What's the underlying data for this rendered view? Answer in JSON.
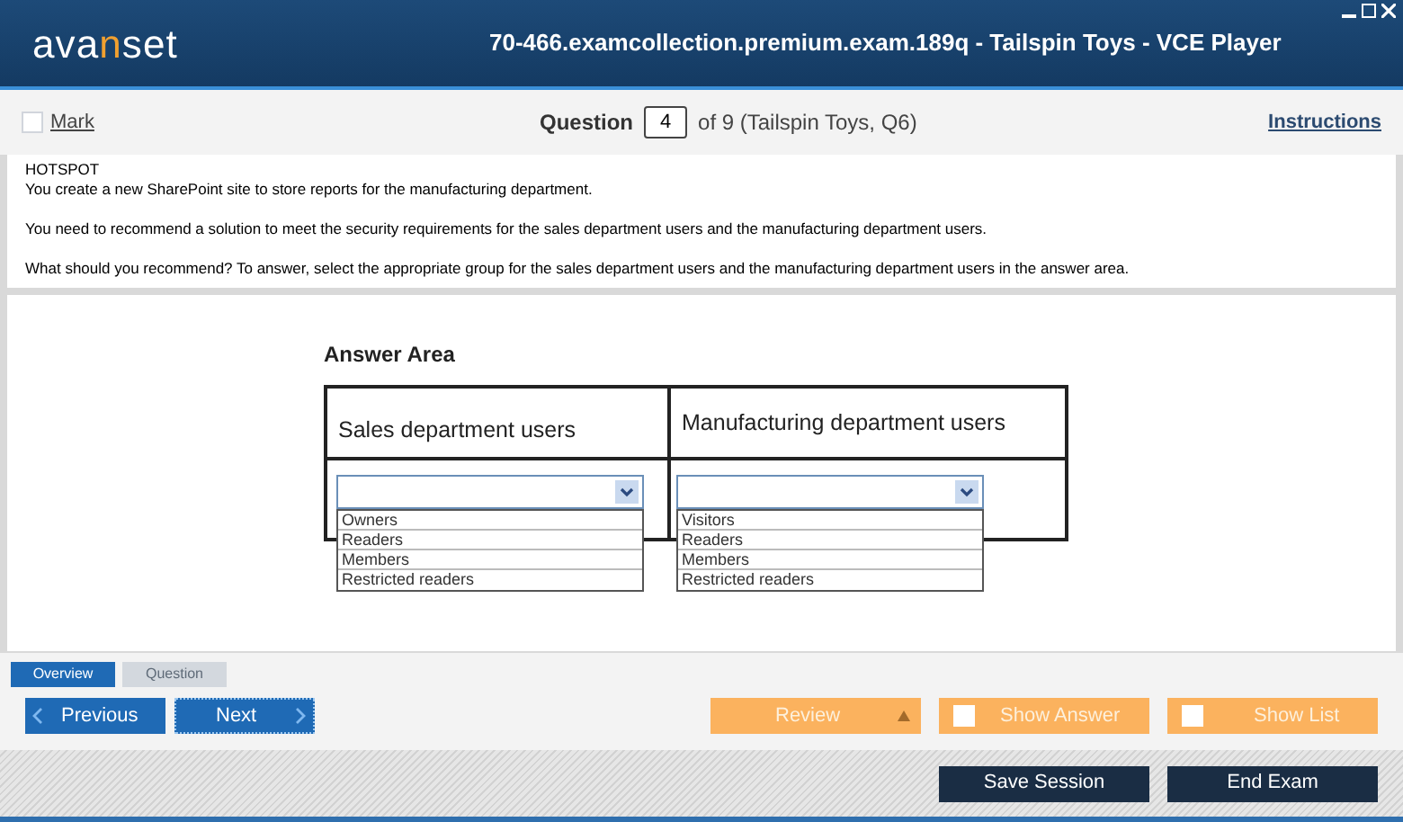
{
  "window": {
    "logo": [
      {
        "text": "ava",
        "accent": false
      },
      {
        "text": "n",
        "accent": true
      },
      {
        "text": "set",
        "accent": false
      }
    ],
    "title": "70-466.examcollection.premium.exam.189q - Tailspin Toys - VCE Player"
  },
  "toolbar": {
    "mark": {
      "label": "Mark",
      "checked": false
    },
    "question_label": "Question",
    "question_number": "4",
    "question_of": "of 9 (Tailspin Toys, Q6)",
    "instructions": "Instructions"
  },
  "question": {
    "paragraphs": [
      "HOTSPOT",
      "You create a new SharePoint site to store reports for the manufacturing department.",
      "You need to recommend a solution to meet the security requirements for the sales department users and the manufacturing department users.",
      "What should you recommend? To answer, select the appropriate group for the sales department users and the manufacturing department users in the answer area."
    ]
  },
  "answer_area": {
    "title": "Answer Area",
    "columns": [
      {
        "heading": "Sales department users",
        "options": [
          "Owners",
          "Readers",
          "Members",
          "Restricted readers"
        ]
      },
      {
        "heading": "Manufacturing department users",
        "options": [
          "Visitors",
          "Readers",
          "Members",
          "Restricted readers"
        ]
      }
    ]
  },
  "tabs": [
    {
      "label": "Overview",
      "selected": true
    },
    {
      "label": "Question",
      "selected": false
    }
  ],
  "nav": {
    "previous": "Previous",
    "next": "Next",
    "review": "Review",
    "show_answer": {
      "label": "Show Answer",
      "checked": false
    },
    "show_list": {
      "label": "Show List",
      "checked": false
    }
  },
  "footer": {
    "buttons": [
      "Save Session",
      "End Exam"
    ]
  }
}
